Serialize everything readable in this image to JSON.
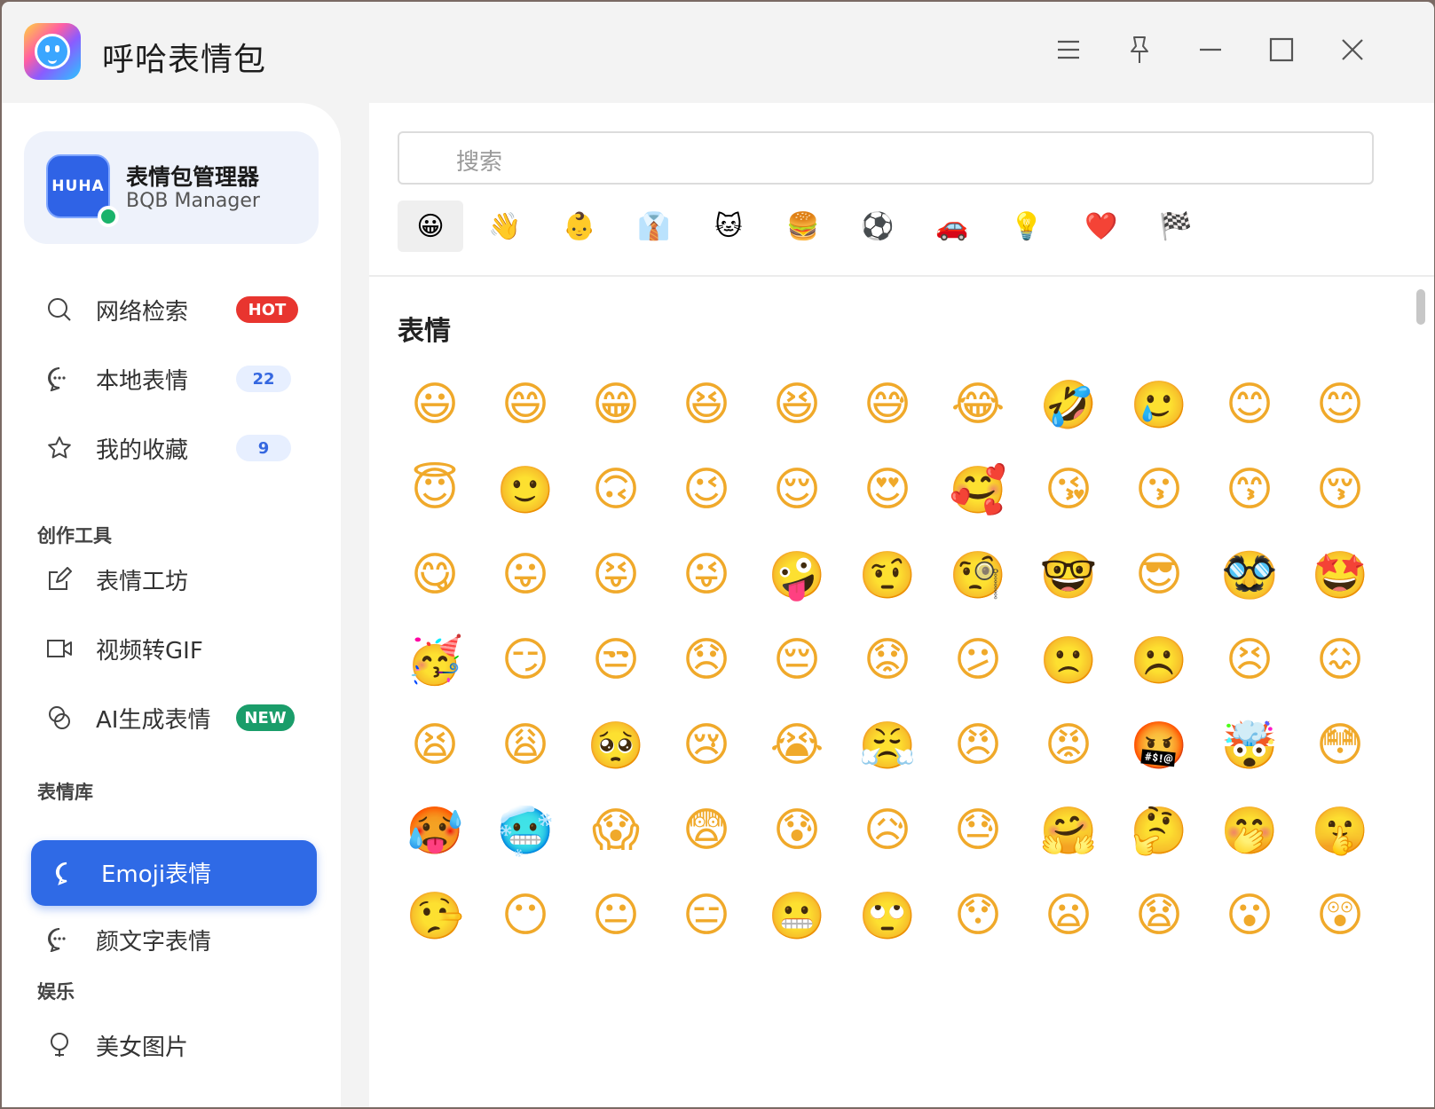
{
  "app": {
    "title": "呼哈表情包"
  },
  "profile": {
    "avatar_text": "HUHA",
    "name": "表情包管理器",
    "subtitle": "BQB Manager"
  },
  "nav": {
    "top": [
      {
        "label": "网络检索",
        "badge": "HOT",
        "icon": "search-icon"
      },
      {
        "label": "本地表情",
        "badge": "22",
        "icon": "chat-icon"
      },
      {
        "label": "我的收藏",
        "badge": "9",
        "icon": "star-icon"
      }
    ],
    "sections": [
      {
        "title": "创作工具",
        "items": [
          {
            "label": "表情工坊",
            "icon": "edit-icon"
          },
          {
            "label": "视频转GIF",
            "icon": "video-icon"
          },
          {
            "label": "AI生成表情",
            "badge": "NEW",
            "icon": "ai-icon"
          }
        ]
      },
      {
        "title": "表情库",
        "items": [
          {
            "label": "Emoji表情",
            "icon": "chat-bubble-icon",
            "active": true
          },
          {
            "label": "颜文字表情",
            "icon": "chat-icon"
          }
        ]
      },
      {
        "title": "娱乐",
        "items": [
          {
            "label": "美女图片",
            "icon": "bulb-icon"
          }
        ]
      }
    ]
  },
  "main": {
    "search_placeholder": "搜索",
    "categories": [
      "😀",
      "👋",
      "👶",
      "👔",
      "🐱",
      "🍔",
      "⚽",
      "🚗",
      "💡",
      "❤️",
      "🏁"
    ],
    "selected_category": 0,
    "section_title": "表情",
    "emojis": [
      [
        "😃",
        "😄",
        "😁",
        "😆",
        "😆",
        "😅",
        "😂",
        "🤣",
        "🥲",
        "😊",
        "😊"
      ],
      [
        "😇",
        "🙂",
        "🙃",
        "😉",
        "😌",
        "😍",
        "🥰",
        "😘",
        "😗",
        "😙",
        "😚"
      ],
      [
        "😋",
        "😛",
        "😝",
        "😜",
        "🤪",
        "🤨",
        "🧐",
        "🤓",
        "😎",
        "🥸",
        "🤩"
      ],
      [
        "🥳",
        "😏",
        "😒",
        "😞",
        "😔",
        "😟",
        "😕",
        "🙁",
        "☹️",
        "😣",
        "😖"
      ],
      [
        "😫",
        "😩",
        "🥺",
        "😢",
        "😭",
        "😤",
        "😠",
        "😡",
        "🤬",
        "🤯",
        "😳"
      ],
      [
        "🥵",
        "🥶",
        "😱",
        "😨",
        "😰",
        "😥",
        "😓",
        "🤗",
        "🤔",
        "🤭",
        "🤫"
      ],
      [
        "🤥",
        "😶",
        "😐",
        "😑",
        "😬",
        "🙄",
        "😯",
        "😦",
        "😧",
        "😮",
        "😲"
      ]
    ]
  },
  "colors": {
    "accent": "#2f6ae6",
    "hot": "#e8352f",
    "new": "#1a9d6a"
  }
}
